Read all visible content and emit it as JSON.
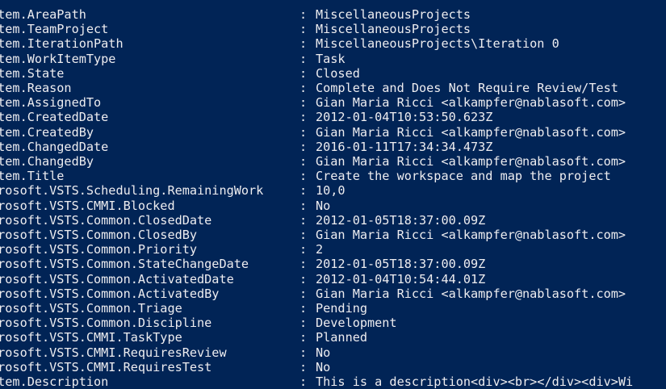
{
  "console": {
    "rows": [
      {
        "key": "Item.AreaPath",
        "value": "MiscellaneousProjects"
      },
      {
        "key": "Item.TeamProject",
        "value": "MiscellaneousProjects"
      },
      {
        "key": "Item.IterationPath",
        "value": "MiscellaneousProjects\\Iteration 0"
      },
      {
        "key": "Item.WorkItemType",
        "value": "Task"
      },
      {
        "key": "Item.State",
        "value": "Closed"
      },
      {
        "key": "Item.Reason",
        "value": "Complete and Does Not Require Review/Test"
      },
      {
        "key": "Item.AssignedTo",
        "value": "Gian Maria Ricci <alkampfer@nablasoft.com>"
      },
      {
        "key": "Item.CreatedDate",
        "value": "2012-01-04T10:53:50.623Z"
      },
      {
        "key": "Item.CreatedBy",
        "value": "Gian Maria Ricci <alkampfer@nablasoft.com>"
      },
      {
        "key": "Item.ChangedDate",
        "value": "2016-01-11T17:34:34.473Z"
      },
      {
        "key": "Item.ChangedBy",
        "value": "Gian Maria Ricci <alkampfer@nablasoft.com>"
      },
      {
        "key": "Item.Title",
        "value": "Create the workspace and map the project"
      },
      {
        "key": "crosoft.VSTS.Scheduling.RemainingWork",
        "value": "10,0"
      },
      {
        "key": "crosoft.VSTS.CMMI.Blocked",
        "value": "No"
      },
      {
        "key": "crosoft.VSTS.Common.ClosedDate",
        "value": "2012-01-05T18:37:00.09Z"
      },
      {
        "key": "crosoft.VSTS.Common.ClosedBy",
        "value": "Gian Maria Ricci <alkampfer@nablasoft.com>"
      },
      {
        "key": "crosoft.VSTS.Common.Priority",
        "value": "2"
      },
      {
        "key": "crosoft.VSTS.Common.StateChangeDate",
        "value": "2012-01-05T18:37:00.09Z"
      },
      {
        "key": "crosoft.VSTS.Common.ActivatedDate",
        "value": "2012-01-04T10:54:44.01Z"
      },
      {
        "key": "crosoft.VSTS.Common.ActivatedBy",
        "value": "Gian Maria Ricci <alkampfer@nablasoft.com>"
      },
      {
        "key": "crosoft.VSTS.Common.Triage",
        "value": "Pending"
      },
      {
        "key": "crosoft.VSTS.Common.Discipline",
        "value": "Development"
      },
      {
        "key": "crosoft.VSTS.CMMI.TaskType",
        "value": "Planned"
      },
      {
        "key": "crosoft.VSTS.CMMI.RequiresReview",
        "value": "No"
      },
      {
        "key": "crosoft.VSTS.CMMI.RequiresTest",
        "value": "No"
      },
      {
        "key": "Item.Description",
        "value": "This is a description<div><br></div><div>Wi"
      }
    ],
    "separator": ":",
    "colors": {
      "background": "#012456",
      "foreground": "#eeedf0"
    }
  }
}
